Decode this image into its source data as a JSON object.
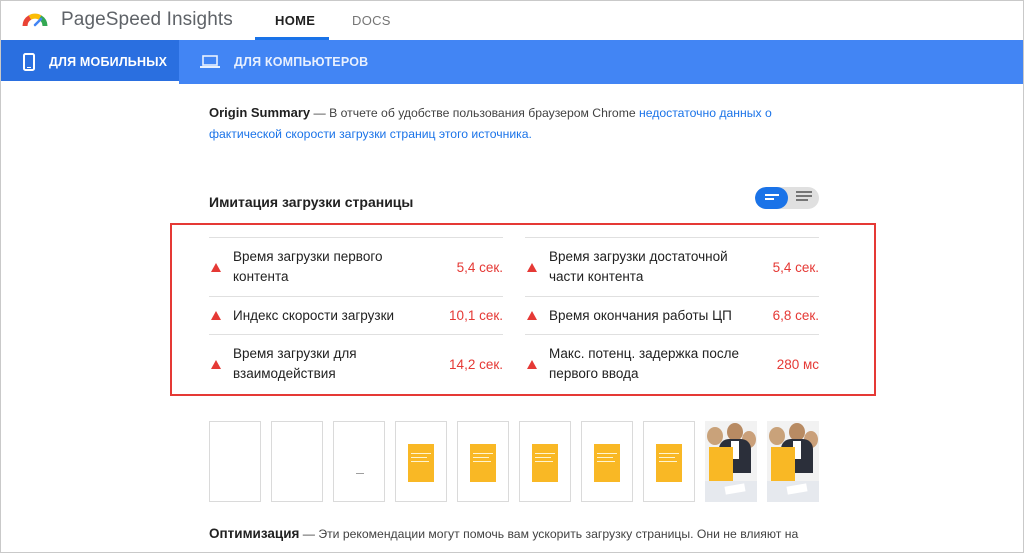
{
  "app": {
    "title": "PageSpeed Insights"
  },
  "nav": {
    "tabs": [
      {
        "label": "HOME",
        "active": true
      },
      {
        "label": "DOCS",
        "active": false
      }
    ]
  },
  "device_tabs": [
    {
      "label": "ДЛЯ МОБИЛЬНЫХ",
      "icon": "smartphone-icon",
      "active": true
    },
    {
      "label": "ДЛЯ КОМПЬЮТЕРОВ",
      "icon": "laptop-icon",
      "active": false
    }
  ],
  "origin_summary": {
    "title": "Origin Summary",
    "dash": " — ",
    "text": "В отчете об удобстве пользования браузером Chrome ",
    "link_text": "недостаточно данных о фактической скорости загрузки страниц этого источника."
  },
  "lab": {
    "title": "Имитация загрузки страницы",
    "toggle": {
      "active_icon": "list-compact-icon",
      "inactive_icon": "list-expanded-icon"
    },
    "metrics_left": [
      {
        "label": "Время загрузки первого контента",
        "value": "5,4 сек.",
        "status": "fail"
      },
      {
        "label": "Индекс скорости загрузки",
        "value": "10,1 сек.",
        "status": "fail"
      },
      {
        "label": "Время загрузки для взаимодействия",
        "value": "14,2 сек.",
        "status": "fail"
      }
    ],
    "metrics_right": [
      {
        "label": "Время загрузки достаточной части контента",
        "value": "5,4 сек.",
        "status": "fail"
      },
      {
        "label": "Время окончания работы ЦП",
        "value": "6,8 сек.",
        "status": "fail"
      },
      {
        "label": "Макс. потенц. задержка после первого ввода",
        "value": "280 мс",
        "status": "fail"
      }
    ]
  },
  "colors": {
    "accent": "#4285f4",
    "fail": "#e53935",
    "link": "#1a73e8",
    "highlight_border": "#e53935"
  },
  "optimization": {
    "title": "Оптимизация",
    "text": " — Эти рекомендации могут помочь вам ускорить загрузку страницы. Они не влияют на"
  }
}
